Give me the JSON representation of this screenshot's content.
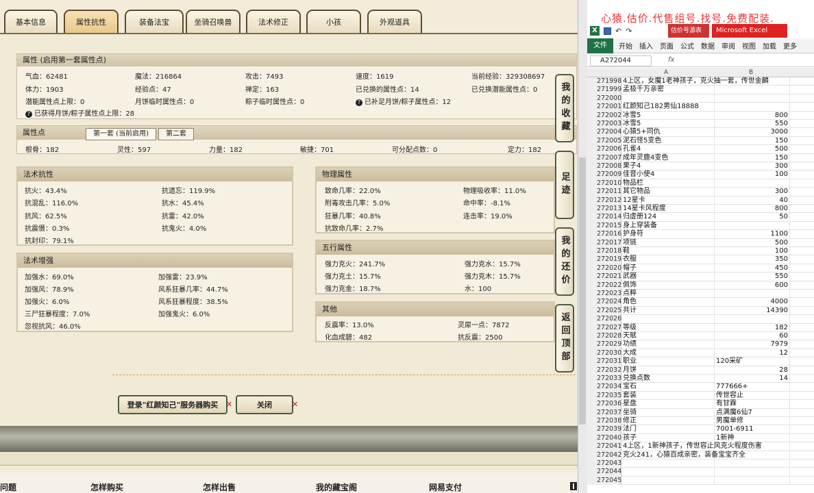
{
  "tabs": [
    "基本信息",
    "属性抗性",
    "装备法宝",
    "坐骑召唤兽",
    "法术修正",
    "小孩",
    "外观道具"
  ],
  "active_tab": "属性抗性",
  "attributes": {
    "header": "属性 (启用第一套属性点)",
    "rows": [
      [
        "气血：62481",
        "魔法：216864",
        "攻击：7493",
        "速度：1619",
        "当前经验：329308697"
      ],
      [
        "体力：1903",
        "经验点：47",
        "禅定：163",
        "已兑换的属性点：14",
        "已兑换潜能属性点：0"
      ],
      [
        "潜能属性点上限：0",
        "月饼临时属性点：0",
        "粽子临时属性点：0",
        "已补足月饼/粽子属性点：12"
      ],
      [
        "已获得月饼/粽子属性点上限：28"
      ]
    ]
  },
  "points": {
    "header": "属性点",
    "subtab_active": "第一套 (当前启用)",
    "subtab_other": "第二套",
    "values": [
      "根骨：182",
      "灵性：597",
      "力量：182",
      "敏捷：701",
      "可分配点数：0",
      "定力：182"
    ]
  },
  "panels": {
    "magic_resist": {
      "title": "法术抗性",
      "items": [
        "抗火：43.4%",
        "抗遗忘：119.9%",
        "抗混乱：116.0%",
        "抗水：45.4%",
        "抗风：62.5%",
        "抗雷：42.0%",
        "抗震慑：0.3%",
        "抗鬼火：4.0%",
        "抗封印：79.1%"
      ]
    },
    "magic_boost": {
      "title": "法术增强",
      "items": [
        "加强水：69.0%",
        "加强雷：23.9%",
        "加强风：78.9%",
        "风系狂暴几率：44.7%",
        "加强火：6.0%",
        "风系狂暴程度：38.5%",
        "三尸狂暴程度：7.0%",
        "加强鬼火：6.0%",
        "忽视抗风：46.0%"
      ]
    },
    "physical": {
      "title": "物理属性",
      "items": [
        "致命几率：22.0%",
        "物理吸收率：11.0%",
        "附毒攻击几率：5.0%",
        "命中率：-8.1%",
        "狂暴几率：40.8%",
        "连击率：19.0%",
        "抗致命几率：2.7%"
      ]
    },
    "elements": {
      "title": "五行属性",
      "items": [
        "强力克火：241.7%",
        "强力克水：15.7%",
        "强力克土：15.7%",
        "强力克木：15.7%",
        "强力克金：18.7%",
        "水：100"
      ]
    },
    "other": {
      "title": "其他",
      "items": [
        "反震率：13.0%",
        "灵犀一点：7872",
        "化血成碧：482",
        "抗反震：2500"
      ]
    }
  },
  "buttons": {
    "login": "登录\"红颜知己\"服务器购买",
    "close": "关闭"
  },
  "side_buttons": [
    "我的收藏",
    "足迹",
    "我的还价",
    "返回顶部"
  ],
  "footer_links": [
    "问题",
    "怎样购买",
    "怎样出售",
    "我的藏宝阁",
    "网易支付"
  ],
  "excel": {
    "banner": "心猿.估价.代售组号.找号.免费配装.",
    "doc_title": "估价号源表",
    "app_title": "Microsoft Excel",
    "ribbon_tabs": [
      "文件",
      "开始",
      "插入",
      "页面",
      "公式",
      "数据",
      "审阅",
      "视图",
      "加载",
      "更多"
    ],
    "name_box": "A272044",
    "fx": "fx",
    "columns": [
      "A",
      "B"
    ],
    "rows": [
      [
        "271998",
        "4上区，女魔1老神孩子，克火抽一套，传世金麟",
        ""
      ],
      [
        "271999",
        "孟极千万亲密",
        ""
      ],
      [
        "272000",
        "",
        ""
      ],
      [
        "272001",
        "红颜知己182男仙18888",
        ""
      ],
      [
        "272002",
        "冰雪5",
        "800"
      ],
      [
        "272003",
        "冰雪5",
        "550"
      ],
      [
        "272004",
        "心猿5+同仇",
        "3000"
      ],
      [
        "272005",
        "泥石怪5变色",
        "150"
      ],
      [
        "272006",
        "孔雀4",
        "500"
      ],
      [
        "272007",
        "成年灵鹿4变色",
        "150"
      ],
      [
        "272008",
        "果子4",
        "300"
      ],
      [
        "272009",
        "佳音小使4",
        "100"
      ],
      [
        "272010",
        "物品栏",
        ""
      ],
      [
        "272011",
        "其它物品",
        "300"
      ],
      [
        "272012",
        "12星卡",
        "40"
      ],
      [
        "272013",
        "14星卡风程度",
        "800"
      ],
      [
        "272014",
        "归虚册124",
        "50"
      ],
      [
        "272015",
        "身上穿装备",
        ""
      ],
      [
        "272016",
        "护身符",
        "1100"
      ],
      [
        "272017",
        "项链",
        "500"
      ],
      [
        "272018",
        "鞋",
        "100"
      ],
      [
        "272019",
        "衣服",
        "350"
      ],
      [
        "272020",
        "帽子",
        "450"
      ],
      [
        "272021",
        "武器",
        "550"
      ],
      [
        "272022",
        "佩饰",
        "600"
      ],
      [
        "272023",
        "点粹",
        ""
      ],
      [
        "272024",
        "角色",
        "4000"
      ],
      [
        "272025",
        "共计",
        "14390"
      ],
      [
        "272026",
        "",
        ""
      ],
      [
        "272027",
        "等级",
        "182"
      ],
      [
        "272028",
        "天赋",
        "60"
      ],
      [
        "272029",
        "功绩",
        "7979"
      ],
      [
        "272030",
        "大成",
        "12"
      ],
      [
        "272031",
        "职业",
        "120采矿"
      ],
      [
        "272032",
        "月饼",
        "28"
      ],
      [
        "272033",
        "兑换点数",
        "14"
      ],
      [
        "272034",
        "宝石",
        "777666+"
      ],
      [
        "272035",
        "套装",
        "传世容止"
      ],
      [
        "272036",
        "星盘",
        "有甘霖"
      ],
      [
        "272037",
        "坐骑",
        "点满魔6仙7"
      ],
      [
        "272038",
        "修正",
        "男魔单修"
      ],
      [
        "272039",
        "法门",
        "7001-6911"
      ],
      [
        "272040",
        "孩子",
        "1新神"
      ],
      [
        "272041",
        "4上区，1新神孩子，传世容止风克火程度伤害",
        ""
      ],
      [
        "272042",
        "克火241，心猿百成亲密，装备宝宝齐全",
        ""
      ],
      [
        "272043",
        "",
        ""
      ],
      [
        "272044",
        "",
        ""
      ],
      [
        "272045",
        "",
        ""
      ]
    ]
  }
}
